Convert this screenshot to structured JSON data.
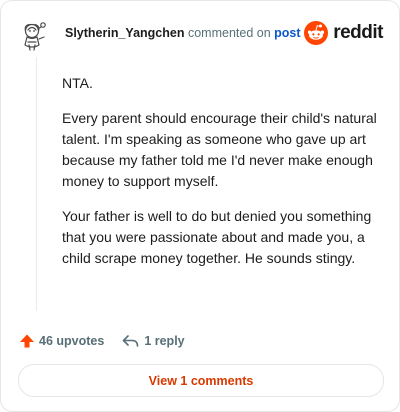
{
  "comment": {
    "author": "Slytherin_Yangchen",
    "action_text": "commented on",
    "post_link_text": "post",
    "paragraphs": [
      "NTA.",
      "Every parent should encourage their child's natural talent. I'm speaking as someone who gave up art because my father told me I'd never make enough money to support myself.",
      "Your father is well to do but denied you something that you were passionate about and made you, a child scrape money together. He sounds stingy."
    ]
  },
  "brand": {
    "wordmark": "reddit",
    "icon": "reddit-snoo-icon",
    "color": "#ff4500"
  },
  "actions": {
    "upvotes_label": "46 upvotes",
    "upvote_icon": "upvote-arrow-icon",
    "upvote_color": "#ff4500",
    "reply_label": "1 reply",
    "reply_icon": "reply-arrow-icon"
  },
  "footer": {
    "view_comments_label": "View 1 comments",
    "accent": "#d93900"
  },
  "avatar": {
    "icon": "default-avatar-icon"
  }
}
